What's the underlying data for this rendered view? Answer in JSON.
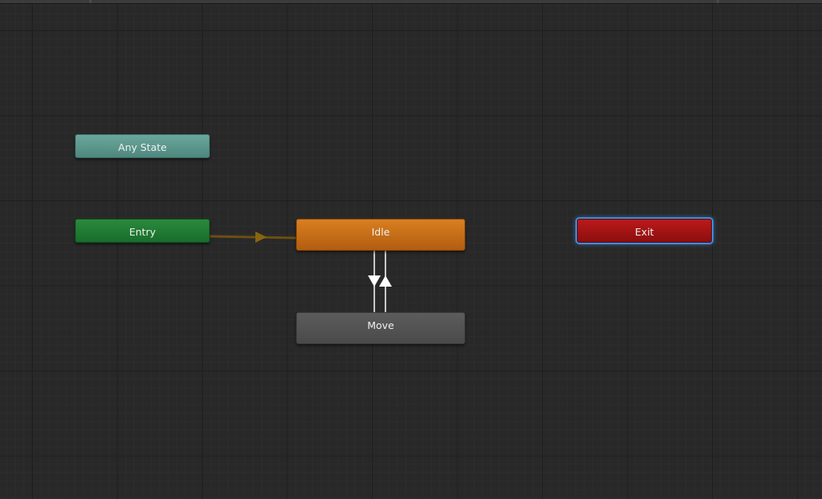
{
  "graph": {
    "nodes": {
      "any_state": {
        "label": "Any State",
        "color": "#5f988e"
      },
      "entry": {
        "label": "Entry",
        "color": "#217c35"
      },
      "idle": {
        "label": "Idle",
        "color": "#c86e19"
      },
      "move": {
        "label": "Move",
        "color": "#545454"
      },
      "exit": {
        "label": "Exit",
        "color": "#a31414"
      }
    },
    "transitions": [
      {
        "from": "Entry",
        "to": "Idle",
        "color": "#6b4f12"
      },
      {
        "from": "Idle",
        "to": "Move",
        "color": "#c8c8c8"
      },
      {
        "from": "Move",
        "to": "Idle",
        "color": "#c8c8c8"
      }
    ],
    "selected_node": "Exit",
    "selection_color": "#3c8de0"
  }
}
